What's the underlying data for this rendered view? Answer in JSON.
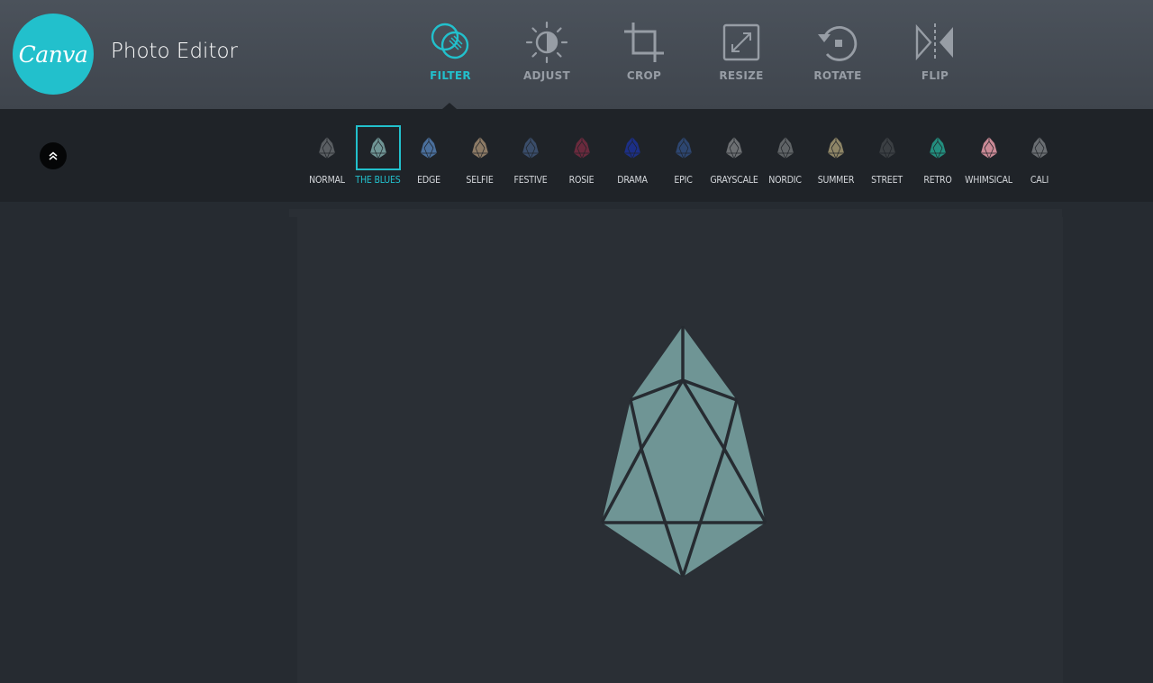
{
  "app": {
    "logo_text": "Canva",
    "title": "Photo Editor"
  },
  "colors": {
    "accent": "#22c0cc",
    "tool_inactive": "#979da5",
    "header_bg": "#454b53",
    "filter_bar_bg": "#1f2328",
    "workspace_bg": "#262b31",
    "image_fill": "#6f9595"
  },
  "toolbar": {
    "tools": [
      {
        "label": "FILTER",
        "icon": "filter-icon",
        "active": true
      },
      {
        "label": "ADJUST",
        "icon": "adjust-sun-icon",
        "active": false
      },
      {
        "label": "CROP",
        "icon": "crop-icon",
        "active": false
      },
      {
        "label": "RESIZE",
        "icon": "resize-icon",
        "active": false
      },
      {
        "label": "ROTATE",
        "icon": "rotate-icon",
        "active": false
      },
      {
        "label": "FLIP",
        "icon": "flip-icon",
        "active": false
      }
    ]
  },
  "filters": {
    "collapse_icon": "double-chevron-up-icon",
    "selected": "THE BLUES",
    "items": [
      {
        "label": "NORMAL",
        "color": "#5a5e62"
      },
      {
        "label": "THE BLUES",
        "color": "#6f9595"
      },
      {
        "label": "EDGE",
        "color": "#4a6f9c"
      },
      {
        "label": "SELFIE",
        "color": "#8c7a65"
      },
      {
        "label": "FESTIVE",
        "color": "#3a4d6a"
      },
      {
        "label": "ROSIE",
        "color": "#6a2a3d"
      },
      {
        "label": "DRAMA",
        "color": "#1c2f86"
      },
      {
        "label": "EPIC",
        "color": "#2d4670"
      },
      {
        "label": "GRAYSCALE",
        "color": "#6c6f72"
      },
      {
        "label": "NORDIC",
        "color": "#5f6366"
      },
      {
        "label": "SUMMER",
        "color": "#8e8566"
      },
      {
        "label": "STREET",
        "color": "#3b3f43"
      },
      {
        "label": "RETRO",
        "color": "#238e7e"
      },
      {
        "label": "WHIMSICAL",
        "color": "#c98995"
      },
      {
        "label": "CALI",
        "color": "#6a6e72"
      }
    ]
  },
  "canvas": {
    "image_icon": "eos-crystal-image"
  }
}
